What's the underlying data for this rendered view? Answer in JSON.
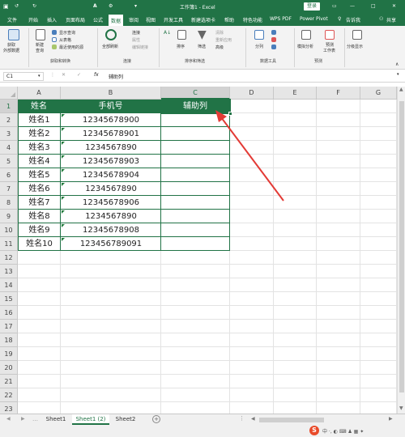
{
  "title_bar": {
    "quick_access": [
      "↺",
      "↻",
      "A",
      "⚙",
      "▾"
    ],
    "window_title": "工作簿1 - Excel",
    "login_label": "登录",
    "window_controls": [
      "—",
      "□",
      "✕"
    ]
  },
  "menu_tabs": [
    "文件",
    "开始",
    "插入",
    "页面布局",
    "公式",
    "数据",
    "审阅",
    "视图",
    "开发工具",
    "新建选项卡",
    "帮助",
    "特色功能",
    "WPS PDF",
    "Power Pivot",
    "告诉我",
    "共享"
  ],
  "active_tab": "数据",
  "ribbon": {
    "get_data": {
      "label1": "获取",
      "label2": "外部数据"
    },
    "new_query": {
      "label1": "新建",
      "label2": "查询"
    },
    "query_items": [
      "显示查询",
      "从表格",
      "最近使用的源"
    ],
    "group_get_transform": "获取和转换",
    "refresh_all": {
      "label1": "全部刷新"
    },
    "connection_items": [
      "连接",
      "属性",
      "编辑链接"
    ],
    "group_connections": "连接",
    "sort_label": "排序",
    "filter_label": "筛选",
    "filter_items": [
      "清除",
      "重新应用",
      "高级"
    ],
    "group_sort_filter": "排序和筛选",
    "split_label": "分列",
    "group_data_tools": "数据工具",
    "whatif_label": "模拟分析",
    "forecast_label1": "预测",
    "forecast_label2": "工作表",
    "group_forecast": "预测",
    "outline_label": "分级显示"
  },
  "formula_bar": {
    "name_box": "C1",
    "fx_label": "fx",
    "formula_value": "辅助列"
  },
  "columns": [
    "A",
    "B",
    "C",
    "D",
    "E",
    "F",
    "G"
  ],
  "selected_column": "C",
  "rows": [
    "1",
    "2",
    "3",
    "4",
    "5",
    "6",
    "7",
    "8",
    "9",
    "10",
    "11",
    "12",
    "13",
    "14",
    "15",
    "16",
    "17",
    "18",
    "19",
    "20",
    "21",
    "22",
    "23"
  ],
  "selected_row": "1",
  "table": {
    "headers": [
      "姓名",
      "手机号",
      "辅助列"
    ],
    "names": [
      "姓名1",
      "姓名2",
      "姓名3",
      "姓名4",
      "姓名5",
      "姓名6",
      "姓名7",
      "姓名8",
      "姓名9",
      "姓名10"
    ],
    "phones": [
      "12345678900",
      "12345678901",
      "1234567890",
      "12345678903",
      "12345678904",
      "1234567890",
      "12345678906",
      "1234567890",
      "12345678908",
      "123456789091"
    ]
  },
  "sheet_tabs": [
    "Sheet1",
    "Sheet1 (2)",
    "Sheet2"
  ],
  "active_sheet": "Sheet1 (2)",
  "add_sheet_label": "+",
  "colors": {
    "excel_green": "#217346",
    "arrow_red": "#e33b36"
  }
}
